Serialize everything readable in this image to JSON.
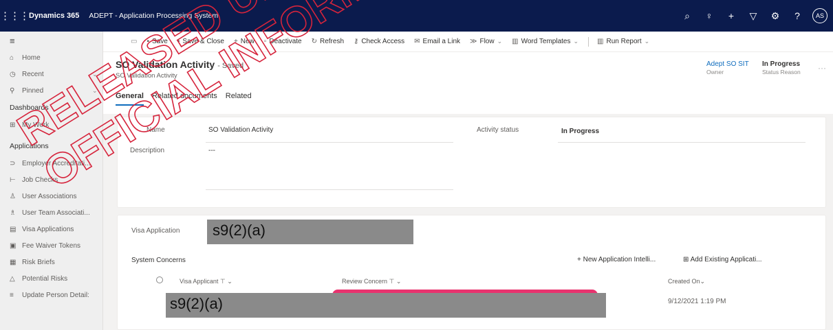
{
  "topbar": {
    "brand": "Dynamics 365",
    "app_title": "ADEPT - Application Processing System",
    "user_initials": "AS",
    "icons": [
      "search-icon",
      "lightbulb-icon",
      "plus-icon",
      "filter-icon",
      "settings-icon",
      "help-icon"
    ]
  },
  "sidebar": {
    "top_items": [
      {
        "label": "Home",
        "icon": "home-icon"
      },
      {
        "label": "Recent",
        "icon": "clock-icon"
      },
      {
        "label": "Pinned",
        "icon": "pin-icon"
      }
    ],
    "dashboards_title": "Dashboards",
    "dashboard_items": [
      {
        "label": "My Work",
        "icon": "grid-icon"
      }
    ],
    "applications_title": "Applications",
    "app_items": [
      {
        "label": "Employer Accreditati...",
        "icon": "link-icon"
      },
      {
        "label": "Job Checks",
        "icon": "check-icon"
      },
      {
        "label": "User Associations",
        "icon": "user-icon"
      },
      {
        "label": "User Team Associati...",
        "icon": "team-icon"
      },
      {
        "label": "Visa Applications",
        "icon": "doc-icon"
      },
      {
        "label": "Fee Waiver Tokens",
        "icon": "token-icon"
      },
      {
        "label": "Risk Briefs",
        "icon": "brief-icon"
      },
      {
        "label": "Potential Risks",
        "icon": "warning-icon"
      },
      {
        "label": "Update Person Detail:",
        "icon": "person-edit-icon"
      }
    ]
  },
  "commands": [
    {
      "label": "Save",
      "icon": "save-icon"
    },
    {
      "label": "Save & Close",
      "icon": "save-close-icon"
    },
    {
      "label": "New",
      "icon": "plus-icon"
    },
    {
      "label": "Deactivate",
      "icon": "deactivate-icon"
    },
    {
      "label": "Refresh",
      "icon": "refresh-icon"
    },
    {
      "label": "Check Access",
      "icon": "key-icon"
    },
    {
      "label": "Email a Link",
      "icon": "email-icon"
    },
    {
      "label": "Flow",
      "icon": "flow-icon"
    },
    {
      "label": "Word Templates",
      "icon": "word-icon"
    },
    {
      "label": "Run Report",
      "icon": "report-icon"
    }
  ],
  "record": {
    "title": "SO Validation Activity",
    "saved_status": "- Saved",
    "subtitle": "SO Validation Activity",
    "owner_value": "Adept SO SIT",
    "owner_label": "Owner",
    "status_value": "In Progress",
    "status_label": "Status Reason"
  },
  "tabs": [
    "General",
    "Related documents",
    "Related"
  ],
  "general": {
    "name_label": "Name",
    "name_value": "SO Validation Activity",
    "description_label": "Description",
    "description_value": "---",
    "activity_status_label": "Activity status",
    "activity_status_value": "In Progress"
  },
  "visa": {
    "label": "Visa Application",
    "redaction": "s9(2)(a)"
  },
  "concerns": {
    "title": "System Concerns",
    "new_button": "New Application Intelli...",
    "add_button": "Add Existing Applicati...",
    "columns": [
      "Visa Applicant",
      "Review Concern",
      "Created On"
    ],
    "row": {
      "redaction": "s9(2)(a)",
      "created_on": "9/12/2021 1:19 PM"
    }
  },
  "watermark": {
    "line1": "RELEASED UNDER",
    "line2": "OFFICIAL INFORMATION"
  }
}
